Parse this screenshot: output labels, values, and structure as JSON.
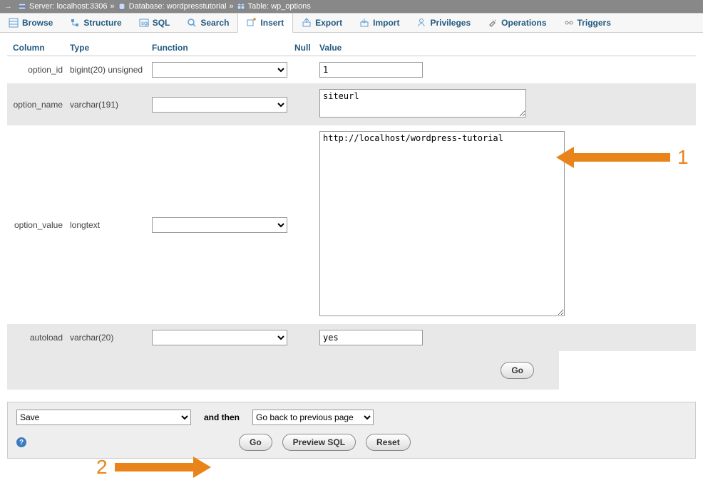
{
  "breadcrumb": {
    "server": "Server: localhost:3306",
    "database": "Database: wordpresstutorial",
    "table": "Table: wp_options"
  },
  "tabs": {
    "browse": "Browse",
    "structure": "Structure",
    "sql": "SQL",
    "search": "Search",
    "insert": "Insert",
    "export": "Export",
    "import": "Import",
    "privileges": "Privileges",
    "operations": "Operations",
    "triggers": "Triggers"
  },
  "headers": {
    "column": "Column",
    "type": "Type",
    "function": "Function",
    "null": "Null",
    "value": "Value"
  },
  "rows": {
    "option_id": {
      "name": "option_id",
      "type": "bigint(20) unsigned",
      "value": "1"
    },
    "option_name": {
      "name": "option_name",
      "type": "varchar(191)",
      "value": "siteurl"
    },
    "option_value": {
      "name": "option_value",
      "type": "longtext",
      "value": "http://localhost/wordpress-tutorial"
    },
    "autoload": {
      "name": "autoload",
      "type": "varchar(20)",
      "value": "yes"
    }
  },
  "buttons": {
    "go": "Go",
    "preview_sql": "Preview SQL",
    "reset": "Reset"
  },
  "footer": {
    "action": "Save",
    "and_then": "and then",
    "then_action": "Go back to previous page"
  },
  "annotations": {
    "n1": "1",
    "n2": "2"
  }
}
